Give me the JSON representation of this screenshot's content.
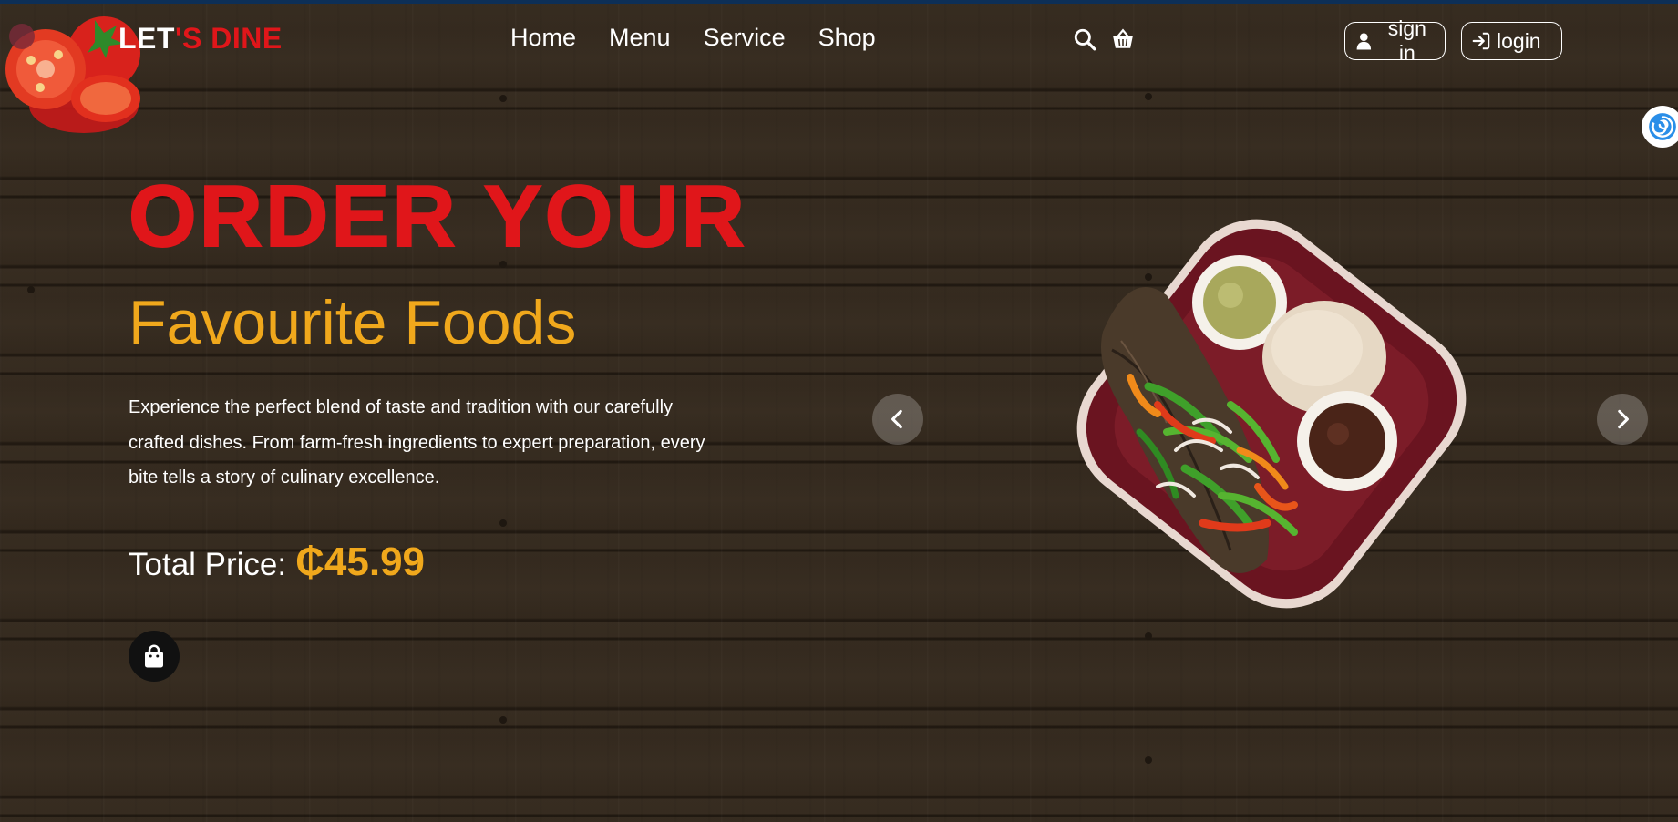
{
  "brand": {
    "part1": "LET",
    "part2": "'S DINE"
  },
  "nav": [
    {
      "label": "Home"
    },
    {
      "label": "Menu"
    },
    {
      "label": "Service"
    },
    {
      "label": "Shop"
    }
  ],
  "header_icons": [
    "search-icon",
    "basket-icon"
  ],
  "auth": {
    "signin_label": "sign in",
    "login_label": "login"
  },
  "hero": {
    "headline": "ORDER YOUR",
    "subheadline": "Favourite Foods",
    "description": "Experience the perfect blend of taste and tradition with our carefully crafted dishes. From farm-fresh ingredients to expert preparation, every bite tells a story of culinary excellence.",
    "price_label": "Total Price:",
    "price_value": "₵45.99"
  },
  "carousel": {
    "prev_icon": "chevron-left-icon",
    "next_icon": "chevron-right-icon"
  },
  "colors": {
    "accent_red": "#e0161a",
    "accent_gold": "#f0a81c",
    "topbar": "#0d2f57",
    "wood": "#3d3226"
  }
}
